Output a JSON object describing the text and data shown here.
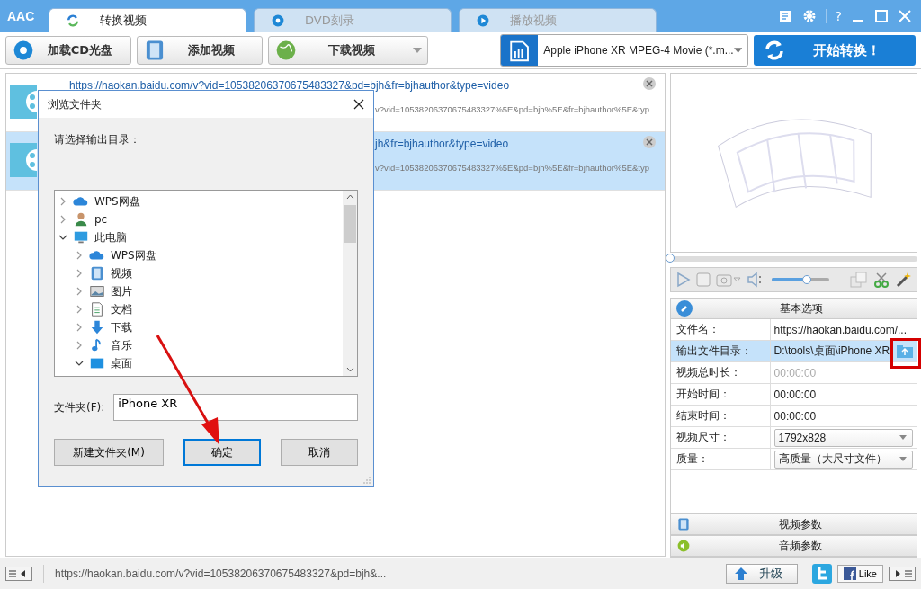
{
  "app": {
    "logo": "AAC"
  },
  "tabs": [
    {
      "label": "转换视频",
      "selected": true
    },
    {
      "label": "DVD刻录",
      "selected": false
    },
    {
      "label": "播放视频",
      "selected": false
    }
  ],
  "window_controls": [
    "?"
  ],
  "toolbar": {
    "buttons": [
      {
        "label": "加载CD光盘",
        "dropdown": false
      },
      {
        "label": "添加视频",
        "dropdown": false
      },
      {
        "label": "下载视频",
        "dropdown": true
      }
    ],
    "format": "Apple iPhone XR MPEG-4 Movie (*.m...",
    "start": "开始转换！"
  },
  "files": [
    {
      "title": "https://haokan.baidu.com/v?vid=10538206370675483327&pd=bjh&fr=bjhauthor&type=video",
      "detail": "v?vid=10538206370675483327%5E&pd=bjh%5E&fr=bjhauthor%5E&typ",
      "selected": false
    },
    {
      "title": "jh&fr=bjhauthor&type=video",
      "detail": "v?vid=10538206370675483327%5E&pd=bjh%5E&fr=bjhauthor%5E&typ",
      "selected": true
    }
  ],
  "player": {
    "seek": {
      "level": 0
    },
    "volume": {
      "level": 0.62
    }
  },
  "basic_options": {
    "title": "基本选项",
    "rows": [
      {
        "label": "文件名：",
        "value": "https://haokan.baidu.com/...",
        "kind": "text",
        "selected": false
      },
      {
        "label": "输出文件目录：",
        "value": "D:\\tools\\桌面\\iPhone XR",
        "kind": "folder",
        "selected": true
      },
      {
        "label": "视频总时长：",
        "value": "00:00:00",
        "kind": "disabled",
        "selected": false
      },
      {
        "label": "开始时间：",
        "value": "00:00:00",
        "kind": "text",
        "selected": false
      },
      {
        "label": "结束时间：",
        "value": "00:00:00",
        "kind": "text",
        "selected": false
      },
      {
        "label": "视频尺寸：",
        "value": "1792x828",
        "kind": "dropdown",
        "selected": false
      },
      {
        "label": "质量：",
        "value": "高质量（大尺寸文件）",
        "kind": "dropdown",
        "selected": false
      }
    ]
  },
  "sections": [
    {
      "title": "视频参数"
    },
    {
      "title": "音频参数"
    }
  ],
  "status_bar": {
    "text": "https://haokan.baidu.com/v?vid=10538206370675483327&pd=bjh&...",
    "upgrade": "升级",
    "like": "Like"
  },
  "dialog": {
    "title": "浏览文件夹",
    "prompt": "请选择输出目录：",
    "tree": [
      {
        "label": "WPS网盘",
        "kind": "cloud",
        "expanded": false
      },
      {
        "label": "pc",
        "kind": "user",
        "expanded": false
      },
      {
        "label": "此电脑",
        "kind": "computer",
        "expanded": true,
        "children": [
          {
            "label": "WPS网盘",
            "kind": "cloud",
            "expanded": false
          },
          {
            "label": "视频",
            "kind": "videos",
            "expanded": false
          },
          {
            "label": "图片",
            "kind": "pictures",
            "expanded": false
          },
          {
            "label": "文档",
            "kind": "documents",
            "expanded": false
          },
          {
            "label": "下载",
            "kind": "downloads",
            "expanded": false
          },
          {
            "label": "音乐",
            "kind": "music",
            "expanded": false
          },
          {
            "label": "桌面",
            "kind": "desktop",
            "expanded": true
          }
        ]
      }
    ],
    "folder_label": "文件夹(F):",
    "folder_value": "iPhone XR",
    "buttons": [
      {
        "label": "新建文件夹(M)",
        "selected": false
      },
      {
        "label": "确定",
        "selected": true
      },
      {
        "label": "取消",
        "selected": false
      }
    ]
  }
}
